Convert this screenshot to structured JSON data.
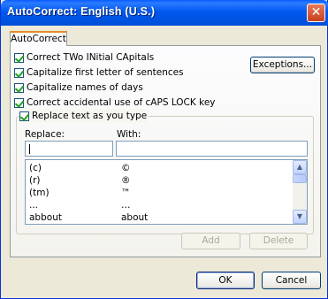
{
  "window": {
    "title": "AutoCorrect: English (U.S.)"
  },
  "tabs": [
    {
      "label": "AutoCorrect"
    }
  ],
  "options": [
    {
      "label": "Correct TWo INitial CApitals",
      "checked": true
    },
    {
      "label": "Capitalize first letter of sentences",
      "checked": true
    },
    {
      "label": "Capitalize names of days",
      "checked": true
    },
    {
      "label": "Correct accidental use of cAPS LOCK key",
      "checked": true
    },
    {
      "label": "Replace text as you type",
      "checked": true
    }
  ],
  "buttons": {
    "exceptions": "Exceptions...",
    "add": "Add",
    "delete": "Delete",
    "ok": "OK",
    "cancel": "Cancel"
  },
  "replace": {
    "replace_label": "Replace:",
    "with_label": "With:",
    "replace_value": "",
    "with_value": ""
  },
  "entries": [
    {
      "replace": "(c)",
      "with": "©"
    },
    {
      "replace": "(r)",
      "with": "®"
    },
    {
      "replace": "(tm)",
      "with": "™"
    },
    {
      "replace": "...",
      "with": "…"
    },
    {
      "replace": "abbout",
      "with": "about"
    }
  ],
  "icons": {
    "close": "close-icon",
    "checkmark": "checkmark-icon"
  }
}
